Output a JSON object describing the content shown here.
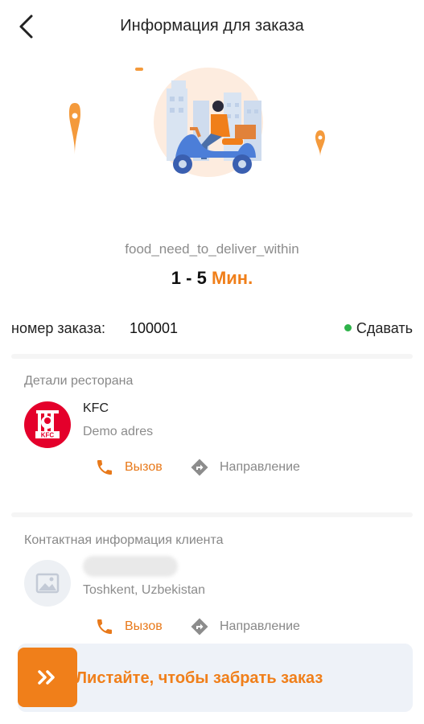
{
  "header": {
    "title": "Информация для заказа",
    "back_icon": "chevron-left-icon"
  },
  "delivery": {
    "label": "food_need_to_deliver_within",
    "time_range": "1 - 5",
    "time_unit": "Мин."
  },
  "order": {
    "number_label": "номер заказа:",
    "number": "100001",
    "status": "Сдавать",
    "status_color": "#2fb34a"
  },
  "restaurant": {
    "section_title": "Детали ресторана",
    "name": "KFC",
    "address": "Demo adres",
    "logo_text": "KFC",
    "call_label": "Вызов",
    "direction_label": "Направление"
  },
  "customer": {
    "section_title": "Контактная информация клиента",
    "address": "Toshkent, Uzbekistan",
    "call_label": "Вызов",
    "direction_label": "Направление"
  },
  "swipe": {
    "label": "Листайте, чтобы забрать заказ",
    "icon": "double-chevron-right-icon"
  },
  "colors": {
    "accent": "#f07f1a",
    "status_green": "#2fb34a",
    "kfc_red": "#e4002b"
  }
}
